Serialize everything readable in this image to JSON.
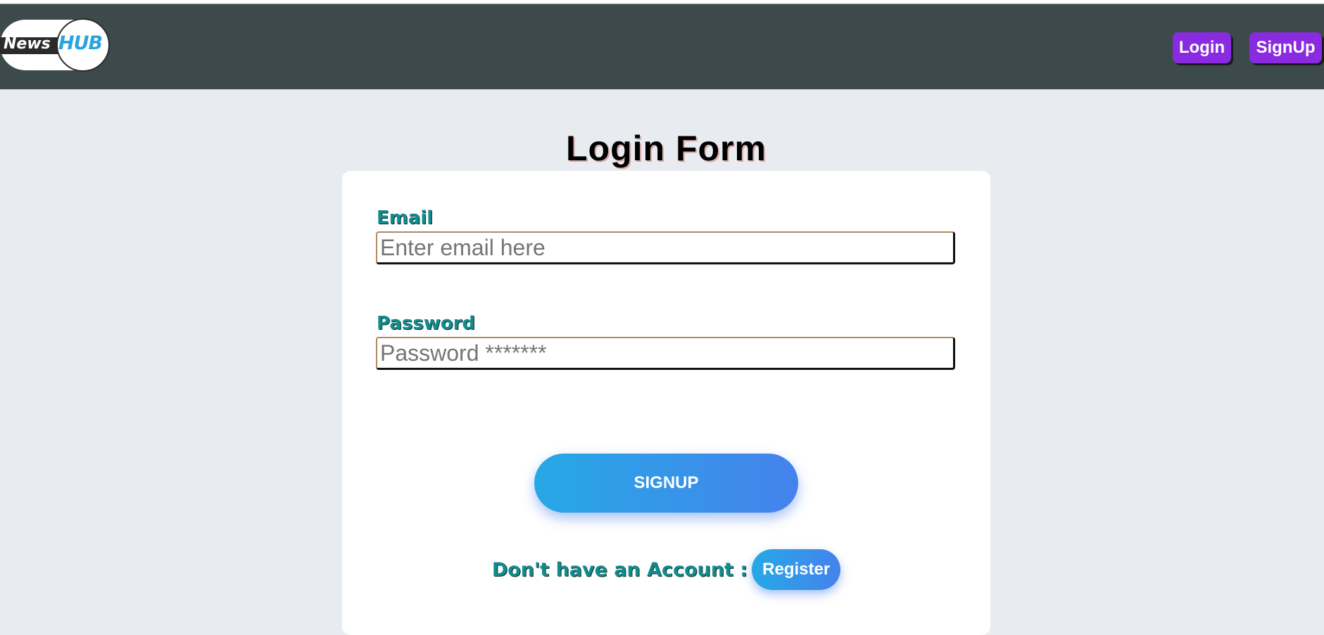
{
  "navbar": {
    "logo": {
      "left_text": "News",
      "right_text": "HUB"
    },
    "buttons": {
      "login": "Login",
      "signup": "SignUp"
    }
  },
  "form": {
    "title": "Login Form",
    "email": {
      "label": "Email",
      "placeholder": "Enter email here",
      "value": ""
    },
    "password": {
      "label": "Password",
      "placeholder": "Password *******",
      "value": ""
    },
    "submit_label": "SIGNUP",
    "account_prompt": "Don't have an Account :",
    "register_label": "Register"
  },
  "colors": {
    "navbar_bg": "#3d4a4b",
    "page_bg": "#e8ebef",
    "nav_button": "#8a2be2",
    "label_teal": "#138b8b",
    "gradient_start": "#26a9e5",
    "gradient_end": "#4582ec"
  }
}
